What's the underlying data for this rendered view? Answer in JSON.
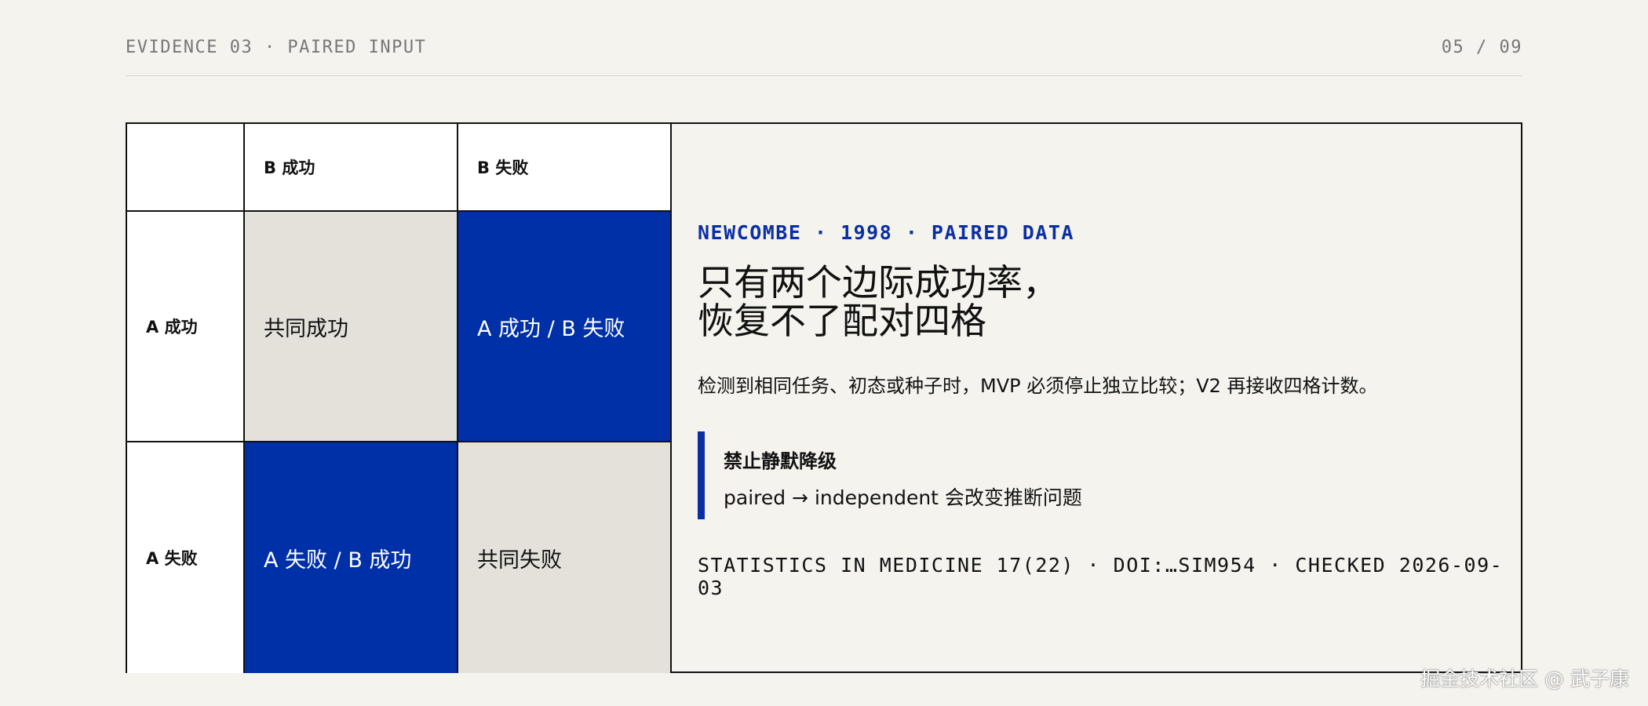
{
  "header": {
    "section": "EVIDENCE 03 · PAIRED INPUT",
    "page": "05 / 09"
  },
  "matrix": {
    "col_headers": [
      "B 成功",
      "B 失败"
    ],
    "row_headers": [
      "A 成功",
      "A 失败"
    ],
    "cells": [
      [
        "共同成功",
        "A 成功 / B 失败"
      ],
      [
        "A 失败 / B 成功",
        "共同失败"
      ]
    ],
    "colors": {
      "blue": "#0030a8",
      "beige": "#e4e1da"
    }
  },
  "panel": {
    "kicker": "NEWCOMBE · 1998 · PAIRED DATA",
    "title_lines": [
      "只有两个边际成功率，",
      "恢复不了配对四格"
    ],
    "description": "检测到相同任务、初态或种子时，MVP 必须停止独立比较；V2 再接收四格计数。",
    "callout": {
      "title": "禁止静默降级",
      "body": "paired → independent 会改变推断问题"
    },
    "citation": "STATISTICS IN MEDICINE 17(22) · DOI:…SIM954 · CHECKED 2026-09-03"
  },
  "watermark": "掘金技术社区 @ 武子康",
  "accent_color": "#0b2fa3"
}
